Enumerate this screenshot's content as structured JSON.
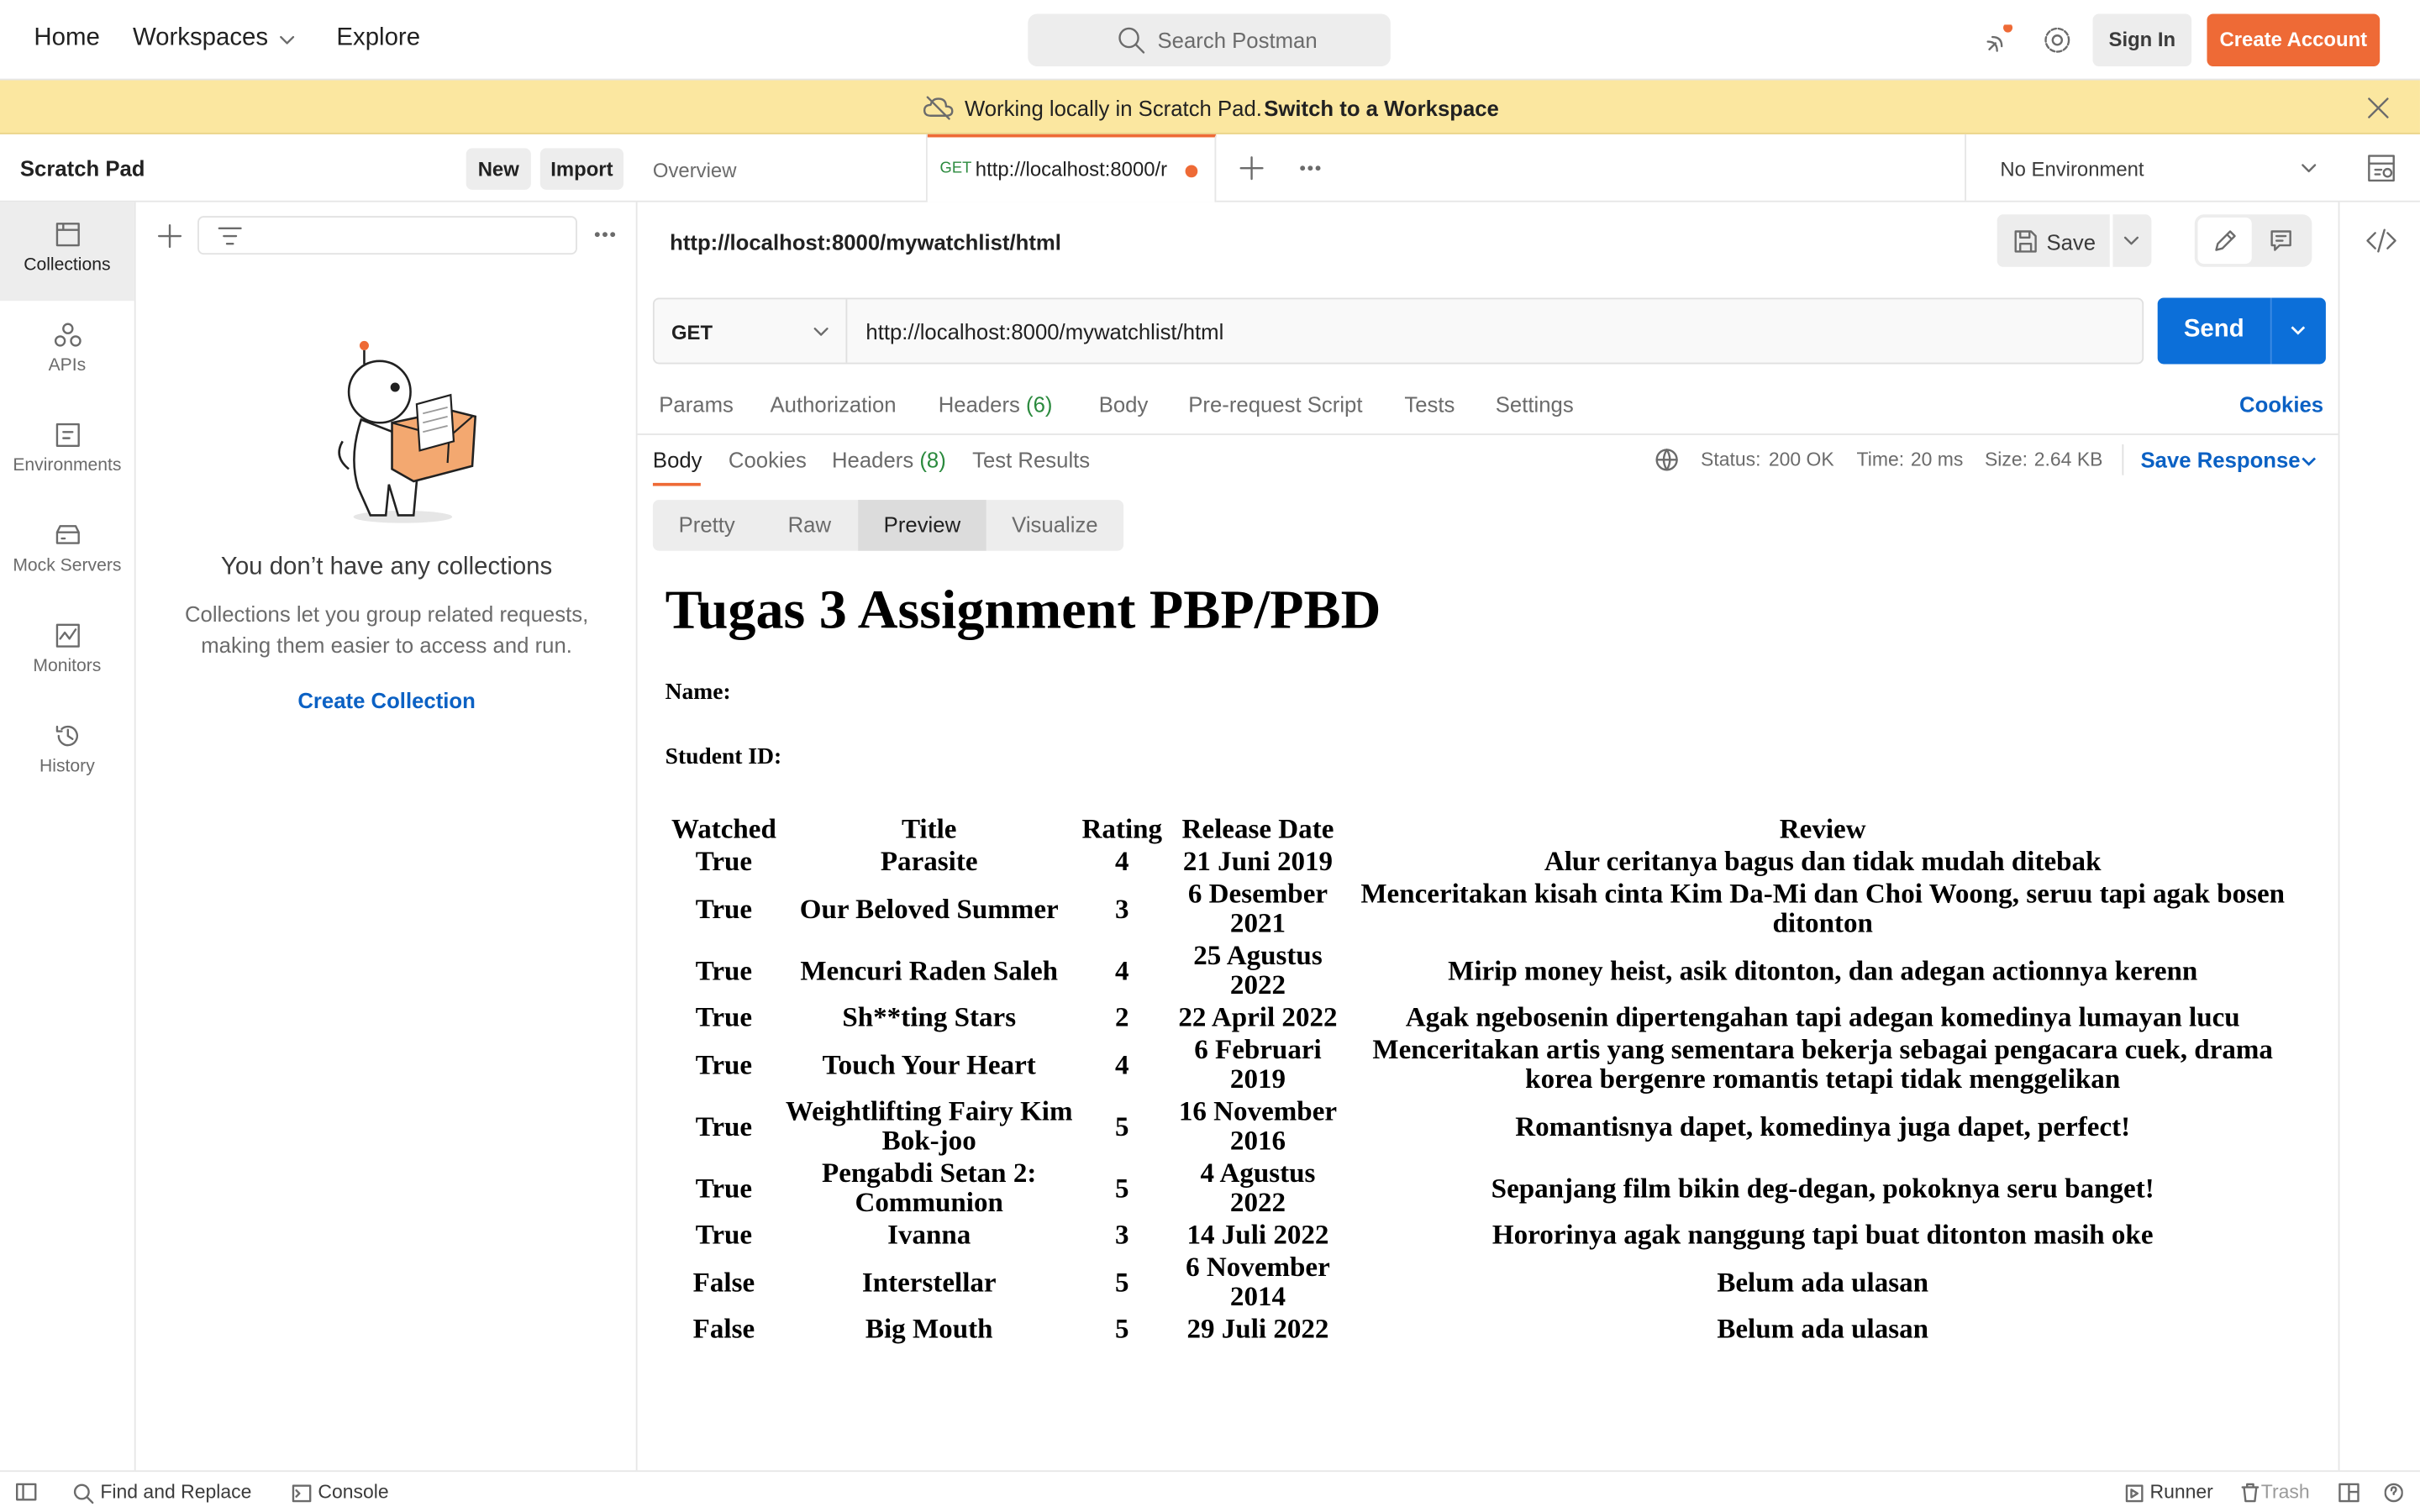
{
  "nav": {
    "home": "Home",
    "workspaces": "Workspaces",
    "explore": "Explore",
    "search_placeholder": "Search Postman",
    "sign_in": "Sign In",
    "create_account": "Create Account"
  },
  "banner": {
    "text": "Working locally in Scratch Pad.",
    "link": "Switch to a Workspace"
  },
  "sidebar": {
    "title": "Scratch Pad",
    "new_label": "New",
    "import_label": "Import",
    "rail": [
      {
        "label": "Collections",
        "icon": "collections-icon"
      },
      {
        "label": "APIs",
        "icon": "apis-icon"
      },
      {
        "label": "Environments",
        "icon": "environments-icon"
      },
      {
        "label": "Mock Servers",
        "icon": "mock-servers-icon"
      },
      {
        "label": "Monitors",
        "icon": "monitors-icon"
      },
      {
        "label": "History",
        "icon": "history-icon"
      }
    ],
    "empty_title": "You don’t have any collections",
    "empty_desc": "Collections let you group related requests, making them easier to access and run.",
    "create_collection": "Create Collection"
  },
  "tabs": {
    "overview": "Overview",
    "request_method": "GET",
    "request_title": "http://localhost:8000/r",
    "environment": "No Environment"
  },
  "request": {
    "name": "http://localhost:8000/mywatchlist/html",
    "save": "Save",
    "method": "GET",
    "url": "http://localhost:8000/mywatchlist/html",
    "send": "Send",
    "tabs": {
      "params": "Params",
      "authorization": "Authorization",
      "headers": "Headers",
      "headers_count": "(6)",
      "body": "Body",
      "prerequest": "Pre-request Script",
      "tests": "Tests",
      "settings": "Settings"
    },
    "cookies": "Cookies"
  },
  "response": {
    "tabs": {
      "body": "Body",
      "cookies": "Cookies",
      "headers": "Headers",
      "headers_count": "(8)",
      "test_results": "Test Results"
    },
    "status_label": "Status:",
    "status_value": "200 OK",
    "time_label": "Time:",
    "time_value": "20 ms",
    "size_label": "Size:",
    "size_value": "2.64 KB",
    "save_response": "Save Response",
    "view_modes": [
      "Pretty",
      "Raw",
      "Preview",
      "Visualize"
    ],
    "active_view": "Preview"
  },
  "preview": {
    "heading": "Tugas 3 Assignment PBP/PBD",
    "name_label": "Name:",
    "student_id_label": "Student ID:",
    "columns": [
      "Watched",
      "Title",
      "Rating",
      "Release Date",
      "Review"
    ],
    "rows": [
      [
        "True",
        "Parasite",
        "4",
        "21 Juni 2019",
        "Alur ceritanya bagus dan tidak mudah ditebak"
      ],
      [
        "True",
        "Our Beloved Summer",
        "3",
        "6 Desember 2021",
        "Menceritakan kisah cinta Kim Da-Mi dan Choi Woong, seruu tapi agak bosen ditonton"
      ],
      [
        "True",
        "Mencuri Raden Saleh",
        "4",
        "25 Agustus 2022",
        "Mirip money heist, asik ditonton, dan adegan actionnya kerenn"
      ],
      [
        "True",
        "Sh**ting Stars",
        "2",
        "22 April 2022",
        "Agak ngebosenin dipertengahan tapi adegan komedinya lumayan lucu"
      ],
      [
        "True",
        "Touch Your Heart",
        "4",
        "6 Februari 2019",
        "Menceritakan artis yang sementara bekerja sebagai pengacara cuek, drama korea bergenre romantis tetapi tidak menggelikan"
      ],
      [
        "True",
        "Weightlifting Fairy Kim Bok-joo",
        "5",
        "16 November 2016",
        "Romantisnya dapet, komedinya juga dapet, perfect!"
      ],
      [
        "True",
        "Pengabdi Setan 2: Communion",
        "5",
        "4 Agustus 2022",
        "Sepanjang film bikin deg-degan, pokoknya seru banget!"
      ],
      [
        "True",
        "Ivanna",
        "3",
        "14 Juli 2022",
        "Hororinya agak nanggung tapi buat ditonton masih oke"
      ],
      [
        "False",
        "Interstellar",
        "5",
        "6 November 2014",
        "Belum ada ulasan"
      ],
      [
        "False",
        "Big Mouth",
        "5",
        "29 Juli 2022",
        "Belum ada ulasan"
      ]
    ]
  },
  "footer": {
    "find_replace": "Find and Replace",
    "console": "Console",
    "runner": "Runner",
    "trash": "Trash"
  },
  "colors": {
    "accent": "#ee6a36",
    "primary_blue": "#0c6fd9",
    "banner_bg": "#fbe7a0",
    "success_green": "#2b8a3e"
  }
}
